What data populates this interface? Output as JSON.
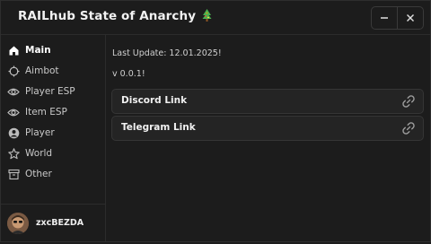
{
  "window": {
    "title": "RAILhub State of Anarchy",
    "title_emoji_icon": "christmas-tree-icon",
    "minimize_icon": "minimize-icon",
    "close_icon": "close-icon"
  },
  "sidebar": {
    "items": [
      {
        "label": "Main",
        "icon": "home-icon",
        "active": true
      },
      {
        "label": "Aimbot",
        "icon": "crosshair-icon",
        "active": false
      },
      {
        "label": "Player ESP",
        "icon": "eye-icon",
        "active": false
      },
      {
        "label": "Item ESP",
        "icon": "eye-icon",
        "active": false
      },
      {
        "label": "Player",
        "icon": "user-icon",
        "active": false
      },
      {
        "label": "World",
        "icon": "star-icon",
        "active": false
      },
      {
        "label": "Other",
        "icon": "archive-icon",
        "active": false
      }
    ]
  },
  "profile": {
    "username": "zxcBEZDA",
    "avatar_icon": "avatar"
  },
  "main": {
    "last_update": "Last Update: 12.01.2025!",
    "version": "v 0.0.1!",
    "links": [
      {
        "label": "Discord Link",
        "icon": "link-icon"
      },
      {
        "label": "Telegram Link",
        "icon": "link-icon"
      }
    ]
  },
  "colors": {
    "background": "#1c1c1c",
    "card": "#242424",
    "border": "#353535",
    "text": "#e6e6e6"
  }
}
